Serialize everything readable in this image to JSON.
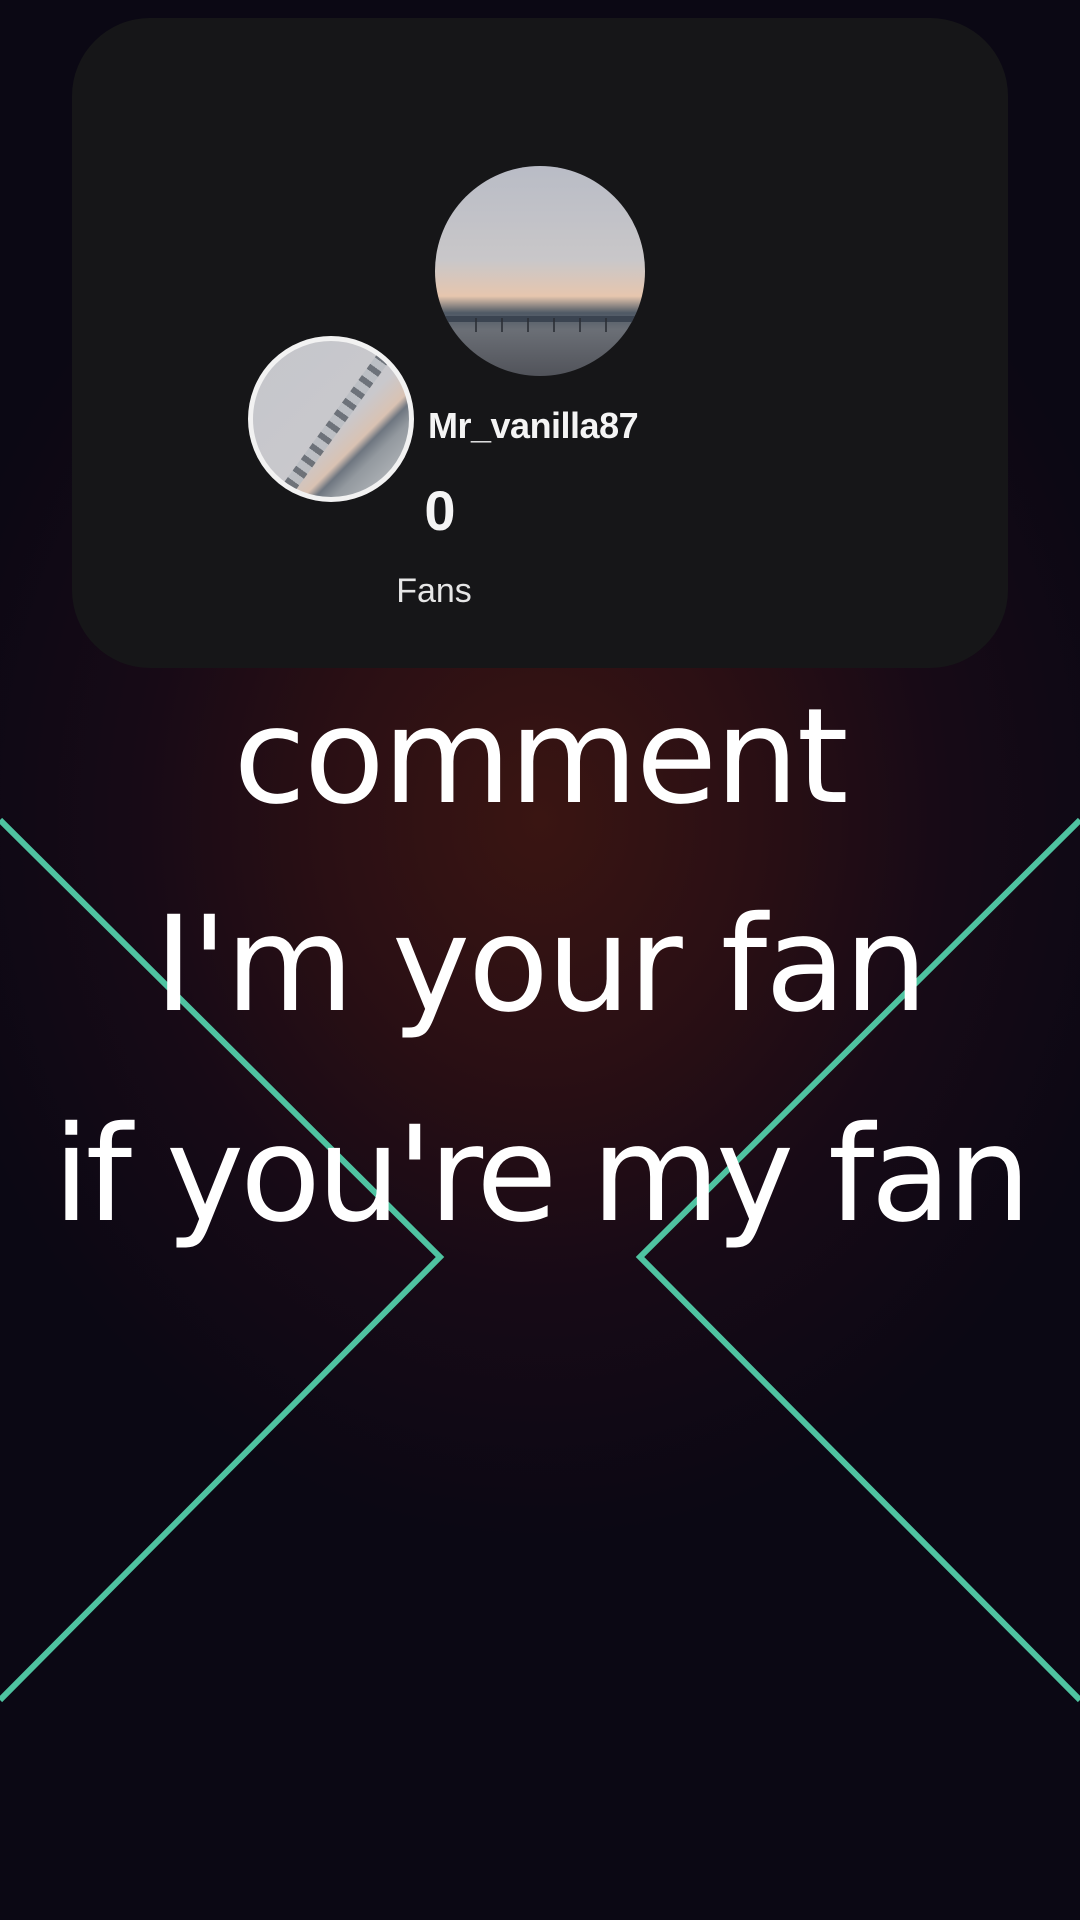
{
  "profile": {
    "username": "Mr_vanilla87",
    "fans_count": "0",
    "fans_label": "Fans"
  },
  "caption": {
    "line1": "comment",
    "line2": "I'm your fan",
    "line3": "if you're my fan"
  },
  "colors": {
    "accent_line": "#4fc3a1",
    "card_bg": "#161618",
    "text": "#ffffff"
  }
}
